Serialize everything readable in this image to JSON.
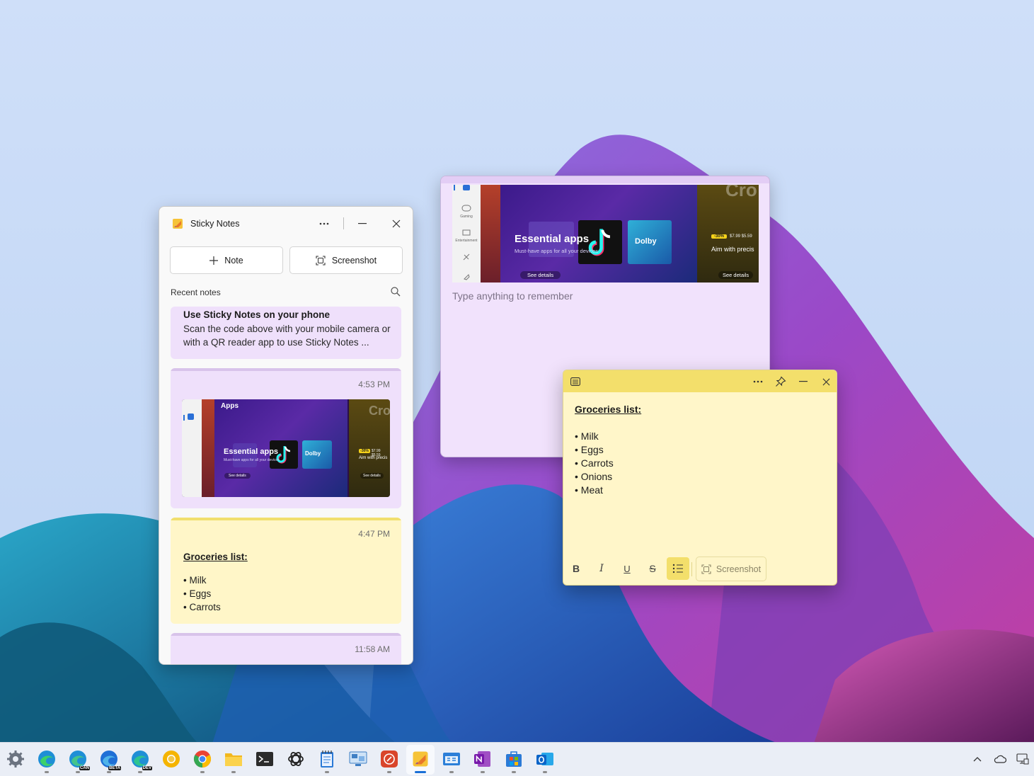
{
  "hub": {
    "title": "Sticky Notes",
    "note_button": "Note",
    "screenshot_button": "Screenshot",
    "recent_label": "Recent notes",
    "notes": [
      {
        "title": "Use Sticky Notes on your phone",
        "text": "Scan the code above with your mobile camera or with a QR reader app to use Sticky Notes ...",
        "color": "#efe0fb"
      },
      {
        "time": "4:53 PM",
        "color": "#efe0fb",
        "image": {
          "apps": "Apps",
          "title": "Essential apps",
          "subtitle": "Must-have apps for all your devices",
          "dolby": "Dolby",
          "details": "See details",
          "aim": "Aim with precis",
          "badge": "-30%",
          "price": "$7.99 $5.59",
          "cro": "Cro"
        }
      },
      {
        "time": "4:47 PM",
        "color": "#fff6c8",
        "title": "Groceries list:",
        "items": [
          "Milk",
          "Eggs",
          "Carrots"
        ]
      },
      {
        "time": "11:58 AM",
        "color": "#efe0fb"
      }
    ]
  },
  "purple_note": {
    "placeholder": "Type anything to remember",
    "image": {
      "title": "Essential apps",
      "subtitle": "Must-have apps for all your devices",
      "dolby": "Dolby",
      "details": "See details",
      "aim": "Aim with precis",
      "badge": "-30%",
      "price": "$7.99 $5.59",
      "cro": "Cro",
      "side": [
        "Gaming",
        "Entertainment"
      ]
    }
  },
  "yellow_note": {
    "title": "Groceries list:",
    "items": [
      "Milk",
      "Eggs",
      "Carrots",
      "Onions",
      "Meat"
    ],
    "toolbar": {
      "bold": "B",
      "italic": "I",
      "underline": "U",
      "strike": "S",
      "screenshot": "Screenshot"
    }
  },
  "taskbar": {
    "apps": [
      {
        "name": "settings-icon"
      },
      {
        "name": "edge-icon"
      },
      {
        "name": "edge-canary-icon",
        "label": "CAN"
      },
      {
        "name": "edge-beta-icon",
        "label": "BETA"
      },
      {
        "name": "edge-dev-icon",
        "label": "DEV"
      },
      {
        "name": "chrome-canary-icon"
      },
      {
        "name": "chrome-icon"
      },
      {
        "name": "file-explorer-icon"
      },
      {
        "name": "terminal-icon"
      },
      {
        "name": "chatgpt-icon"
      },
      {
        "name": "notepad-icon"
      },
      {
        "name": "remote-desktop-icon"
      },
      {
        "name": "remote-app-icon"
      },
      {
        "name": "sticky-notes-icon"
      },
      {
        "name": "windows-app-icon"
      },
      {
        "name": "onenote-icon"
      },
      {
        "name": "store-icon"
      },
      {
        "name": "outlook-icon"
      }
    ]
  },
  "colors": {
    "purple_note": "#f1e2fc",
    "yellow_note": "#fff6c9",
    "yellow_bar": "#f3df6b",
    "accent": "#1a6fd6"
  }
}
